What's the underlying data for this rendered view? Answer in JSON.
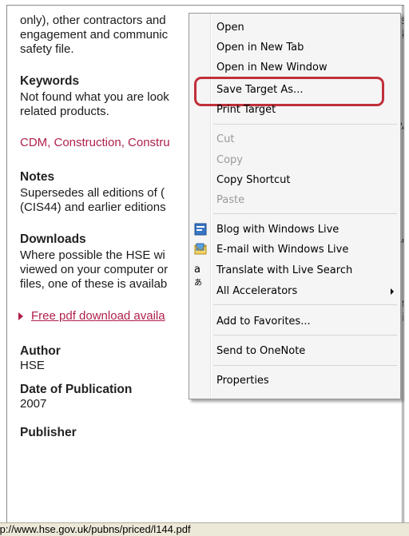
{
  "page": {
    "line1": "only), other contractors and",
    "line2": "engagement and communic",
    "line3": "safety file.",
    "keywords_heading": "Keywords",
    "kw_line1": "Not found what you are look",
    "kw_line2": "related products.",
    "kw_links": "CDM, Construction, Constru",
    "notes_heading": "Notes",
    "notes_line1": "Supersedes all editions of (",
    "notes_line2": "(CIS44) and earlier editions",
    "downloads_heading": "Downloads",
    "dl_line1": "Where possible the HSE wi",
    "dl_line2": "viewed on your computer or",
    "dl_line3": "files, one of these is availab",
    "download_link": "Free pdf download availa",
    "author_heading": "Author",
    "author_value": "HSE",
    "date_heading": "Date of Publication",
    "date_value": "2007",
    "publisher_heading": "Publisher",
    "cut_right_1": "s",
    "cut_right_2": "k",
    "cut_right_3": "w",
    "cut_right_4": "40",
    "cut_right_5": "n",
    "cut_right_6": "il"
  },
  "status_bar": {
    "url": "tp://www.hse.gov.uk/pubns/priced/l144.pdf"
  },
  "context_menu": {
    "items": [
      {
        "label": "Open"
      },
      {
        "label": "Open in New Tab"
      },
      {
        "label": "Open in New Window"
      },
      {
        "label": "Save Target As..."
      },
      {
        "label": "Print Target"
      },
      {
        "label": "Cut"
      },
      {
        "label": "Copy"
      },
      {
        "label": "Copy Shortcut"
      },
      {
        "label": "Paste"
      },
      {
        "label": "Blog with Windows Live"
      },
      {
        "label": "E-mail with Windows Live"
      },
      {
        "label": "Translate with Live Search"
      },
      {
        "label": "All Accelerators"
      },
      {
        "label": "Add to Favorites..."
      },
      {
        "label": "Send to OneNote"
      },
      {
        "label": "Properties"
      }
    ],
    "highlight_color": "#c0303a"
  }
}
